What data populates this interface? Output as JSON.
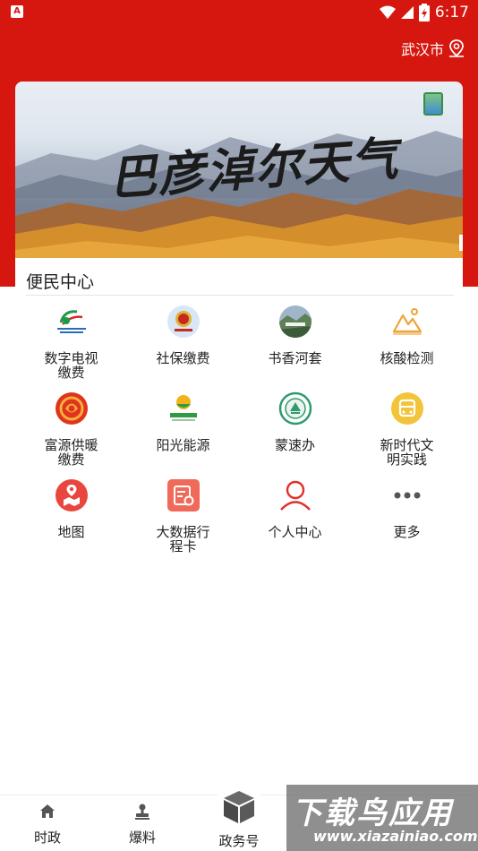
{
  "status_bar": {
    "time": "6:17",
    "battery_level": "6"
  },
  "header": {
    "location": "武汉市"
  },
  "banner": {
    "title": "巴彦淖尔天气"
  },
  "section": {
    "title": "便民中心"
  },
  "services": [
    {
      "label": "数字电视\n缴费",
      "icon": "digital-tv-logo-icon"
    },
    {
      "label": "社保缴费",
      "icon": "social-security-emblem-icon"
    },
    {
      "label": "书香河套",
      "icon": "book-scenery-icon"
    },
    {
      "label": "核酸检测",
      "icon": "mountain-sun-icon"
    },
    {
      "label": "富源供暖\n缴费",
      "icon": "heating-logo-icon"
    },
    {
      "label": "阳光能源",
      "icon": "sunshine-energy-logo-icon"
    },
    {
      "label": "蒙速办",
      "icon": "mengsuban-logo-icon"
    },
    {
      "label": "新时代文\n明实践",
      "icon": "bus-icon"
    },
    {
      "label": "地图",
      "icon": "map-icon"
    },
    {
      "label": "大数据行\n程卡",
      "icon": "itinerary-card-icon"
    },
    {
      "label": "个人中心",
      "icon": "person-icon"
    },
    {
      "label": "更多",
      "icon": "more-dots-icon"
    }
  ],
  "nav": [
    {
      "label": "时政",
      "icon": "home-icon"
    },
    {
      "label": "爆料",
      "icon": "stamp-icon"
    },
    {
      "label": "政务号",
      "icon": "cube-icon"
    }
  ],
  "watermark": {
    "big": "下载鸟应用",
    "small": "www.xiazainiao.com"
  },
  "colors": {
    "brand_red": "#d5170f"
  }
}
